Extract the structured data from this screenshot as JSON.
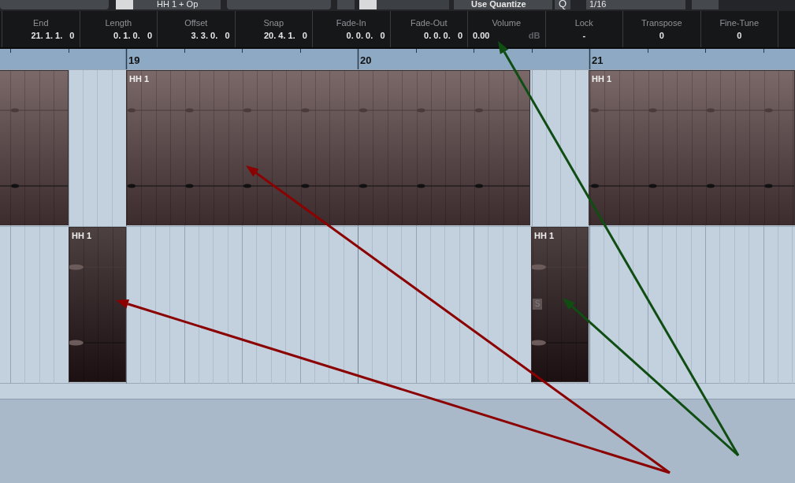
{
  "toolbar": {
    "track_preset": "HH 1 + Op",
    "snap_type": "Use Quantize",
    "quantize_label": "Q",
    "quantize_value": "1/16"
  },
  "info_line": [
    {
      "label": "End",
      "value": "21. 1. 1.   0"
    },
    {
      "label": "Length",
      "value": "0. 1. 0.   0"
    },
    {
      "label": "Offset",
      "value": "3. 3. 0.   0"
    },
    {
      "label": "Snap",
      "value": "20. 4. 1.   0"
    },
    {
      "label": "Fade-In",
      "value": "0. 0. 0.   0"
    },
    {
      "label": "Fade-Out",
      "value": "0. 0. 0.   0"
    },
    {
      "label": "Volume",
      "value": "0.00",
      "unit": "dB"
    },
    {
      "label": "Lock",
      "value": "-"
    },
    {
      "label": "Transpose",
      "value": "0"
    },
    {
      "label": "Fine-Tune",
      "value": "0"
    }
  ],
  "ruler": {
    "bars": [
      "19",
      "20",
      "21"
    ]
  },
  "tracks": [
    {
      "events": [
        {
          "cut_off": true
        },
        {
          "name": "HH 1",
          "cut_off": false
        },
        {
          "name": "HH 1",
          "cut_off": false
        }
      ]
    },
    {
      "events": [
        {
          "name": "HH 1"
        },
        {
          "name": "HH 1",
          "badge": "S"
        }
      ]
    }
  ],
  "annotations": [
    {
      "color": "#8b0000"
    },
    {
      "color": "#8b0000"
    },
    {
      "color": "#0f4d12"
    },
    {
      "color": "#0f4d12"
    }
  ]
}
